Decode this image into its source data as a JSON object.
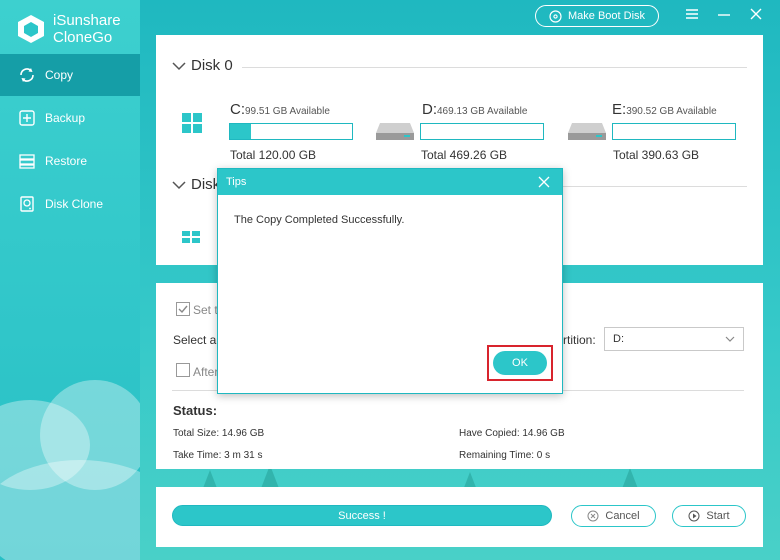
{
  "app": {
    "name_line1": "iSunshare",
    "name_line2": "CloneGo"
  },
  "topbar": {
    "boot_disk_label": "Make Boot Disk"
  },
  "sidebar": {
    "items": [
      {
        "label": "Copy",
        "icon": "copy-icon",
        "active": true
      },
      {
        "label": "Backup",
        "icon": "backup-icon",
        "active": false
      },
      {
        "label": "Restore",
        "icon": "restore-icon",
        "active": false
      },
      {
        "label": "Disk Clone",
        "icon": "disk-clone-icon",
        "active": false
      }
    ]
  },
  "disks": [
    {
      "name": "Disk 0",
      "partitions": [
        {
          "letter": "C:",
          "available": "99.51 GB Available",
          "total": "Total 120.00 GB",
          "used_fraction": 0.17,
          "icon": "windows-drive-icon"
        },
        {
          "letter": "D:",
          "available": "469.13 GB Available",
          "total": "Total 469.26 GB",
          "used_fraction": 0.0,
          "icon": "hard-drive-icon"
        },
        {
          "letter": "E:",
          "available": "390.52 GB Available",
          "total": "Total 390.63 GB",
          "used_fraction": 0.0,
          "icon": "hard-drive-icon"
        }
      ]
    },
    {
      "name": "Disk"
    }
  ],
  "settings": {
    "set_target_label": "Set t",
    "select_label": "Select a",
    "partition_label": "rtition:",
    "partition_value": "D:",
    "after_label": "After"
  },
  "status": {
    "title": "Status:",
    "total_size": "Total Size: 14.96 GB",
    "take_time": "Take Time: 3 m 31 s",
    "have_copied": "Have Copied: 14.96 GB",
    "remaining_time": "Remaining Time: 0 s"
  },
  "bottom": {
    "progress_label": "Success !",
    "progress_fraction": 1.0,
    "cancel_label": "Cancel",
    "start_label": "Start"
  },
  "dialog": {
    "title": "Tips",
    "message": "The Copy Completed Successfully.",
    "ok_label": "OK"
  },
  "colors": {
    "accent": "#2cc6c9",
    "active_nav": "#159ea7",
    "highlight": "#d8242d"
  }
}
